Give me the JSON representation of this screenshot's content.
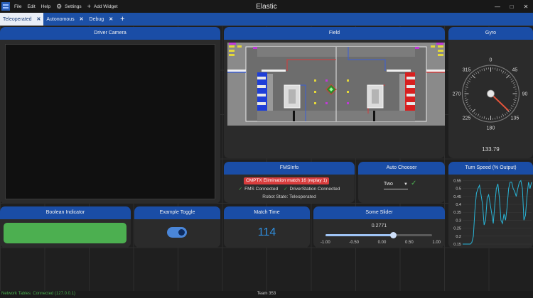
{
  "app": {
    "title": "Elastic",
    "menu": {
      "file": "File",
      "edit": "Edit",
      "help": "Help",
      "settings": "Settings",
      "add_widget": "Add Widget"
    },
    "window": {
      "minimize": "—",
      "maximize": "□",
      "close": "✕"
    }
  },
  "tabs": [
    {
      "label": "Teleoperated",
      "active": true
    },
    {
      "label": "Autonomous",
      "active": false
    },
    {
      "label": "Debug",
      "active": false
    }
  ],
  "tab_close_glyph": "✕",
  "tab_add_glyph": "+",
  "widgets": {
    "driver_camera": {
      "title": "Driver Camera"
    },
    "field": {
      "title": "Field"
    },
    "gyro": {
      "title": "Gyro",
      "value": "133.79",
      "heading_deg": 133.79,
      "dial_labels": [
        "0",
        "45",
        "90",
        "135",
        "180",
        "225",
        "270",
        "315"
      ]
    },
    "fms_info": {
      "title": "FMSInfo",
      "match": "CMPTX Elimination match 16 (replay 1)",
      "fms_connected": "FMS Connected",
      "ds_connected": "DriverStation Connected",
      "robot_state": "Robot State: Teleoperated"
    },
    "auto_chooser": {
      "title": "Auto Chooser",
      "selected": "Two"
    },
    "turn_speed": {
      "title": "Turn Speed (% Output)",
      "y_ticks": [
        "0.55",
        "0.5",
        "0.45",
        "0.4",
        "0.35",
        "0.3",
        "0.25",
        "0.2",
        "0.15"
      ]
    },
    "boolean_indicator": {
      "title": "Boolean Indicator",
      "value": true,
      "true_color": "#4caf50"
    },
    "example_toggle": {
      "title": "Example Toggle",
      "value": true
    },
    "match_time": {
      "title": "Match Time",
      "value": "114"
    },
    "some_slider": {
      "title": "Some Slider",
      "value": "0.2771",
      "value_num": 0.2771,
      "min": -1,
      "max": 1,
      "labels": [
        "-1.00",
        "-0.50",
        "0.00",
        "0.50",
        "1.00"
      ]
    }
  },
  "chart_data": {
    "type": "line",
    "title": "Turn Speed (% Output)",
    "ylim": [
      0.15,
      0.57
    ],
    "series": [
      {
        "values": [
          0.15,
          0.15,
          0.15,
          0.15,
          0.15,
          0.15,
          0.16,
          0.2,
          0.36,
          0.47,
          0.5,
          0.52,
          0.46,
          0.4,
          0.27,
          0.3,
          0.44,
          0.46,
          0.4,
          0.34,
          0.28,
          0.4,
          0.5,
          0.53,
          0.44,
          0.3,
          0.28,
          0.34,
          0.3,
          0.38,
          0.5,
          0.54,
          0.54,
          0.5,
          0.48,
          0.45,
          0.5,
          0.54,
          0.55,
          0.5,
          0.3,
          0.33,
          0.45,
          0.54,
          0.5,
          0.54
        ]
      }
    ]
  },
  "status": {
    "network": "Network Tables: Connected (127.0.0.1)",
    "team": "Team 353"
  },
  "colors": {
    "accent": "#1a4da6",
    "success": "#4caf50",
    "match_time": "#2f8fe0",
    "alert": "#d83d3d"
  },
  "icons": {
    "settings": "gear-icon",
    "add_widget": "plus-icon",
    "check": "check-icon"
  }
}
